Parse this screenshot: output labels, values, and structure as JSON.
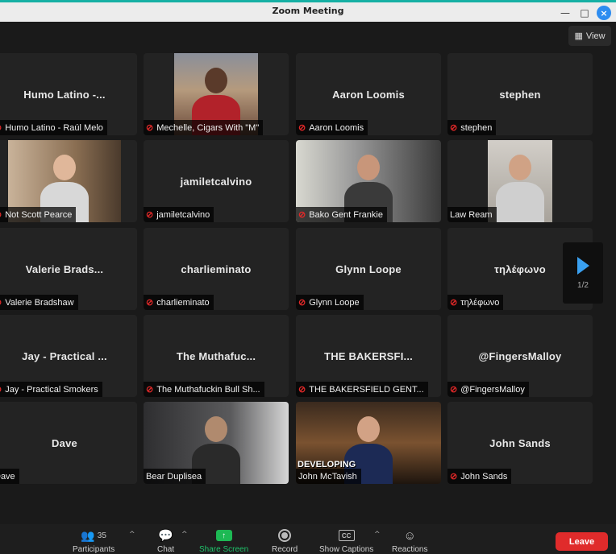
{
  "window": {
    "title": "Zoom Meeting",
    "minimize": "—",
    "maximize": "□",
    "close": "×"
  },
  "view_button": {
    "icon": "grid-icon",
    "label": "View"
  },
  "pager": {
    "page": "1/2"
  },
  "tiles": [
    {
      "big": "Humo Latino -...",
      "label": "Humo Latino - Raúl Melo",
      "muted": true,
      "video": false
    },
    {
      "big": "",
      "label": "Mechelle, Cigars With \"M\"",
      "muted": true,
      "video": true
    },
    {
      "big": "Aaron Loomis",
      "label": "Aaron Loomis",
      "muted": true,
      "video": false
    },
    {
      "big": "stephen",
      "label": "stephen",
      "muted": true,
      "video": false
    },
    {
      "big": "",
      "label": "Not Scott Pearce",
      "muted": true,
      "video": true
    },
    {
      "big": "jamiletcalvino",
      "label": "jamiletcalvino",
      "muted": true,
      "video": false
    },
    {
      "big": "",
      "label": "Bako Gent Frankie",
      "muted": true,
      "video": true
    },
    {
      "big": "",
      "label": "Law Ream",
      "muted": false,
      "video": true
    },
    {
      "big": "Valerie Brads...",
      "label": "Valerie Bradshaw",
      "muted": true,
      "video": false
    },
    {
      "big": "charlieminato",
      "label": "charlieminato",
      "muted": true,
      "video": false
    },
    {
      "big": "Glynn Loope",
      "label": "Glynn Loope",
      "muted": true,
      "video": false
    },
    {
      "big": "τηλέφωνο",
      "label": "τηλέφωνο",
      "muted": true,
      "video": false
    },
    {
      "big": "Jay - Practical ...",
      "label": "Jay - Practical Smokers",
      "muted": true,
      "video": false
    },
    {
      "big": "The Muthafuc...",
      "label": "The Muthafuckin Bull Sh...",
      "muted": true,
      "video": false
    },
    {
      "big": "THE BAKERSFI...",
      "label": "THE BAKERSFIELD GENT...",
      "muted": true,
      "video": false
    },
    {
      "big": "@FingersMalloy",
      "label": "@FingersMalloy",
      "muted": true,
      "video": false
    },
    {
      "big": "Dave",
      "label": "Dave",
      "muted": false,
      "video": false
    },
    {
      "big": "",
      "label": "Bear Duplisea",
      "muted": false,
      "video": true
    },
    {
      "big": "",
      "label": "John McTavish",
      "muted": false,
      "video": true,
      "video_text": "DEVELOPING"
    },
    {
      "big": "John Sands",
      "label": "John Sands",
      "muted": true,
      "video": false
    }
  ],
  "toolbar": {
    "participants": {
      "label": "Participants",
      "count": "35",
      "icon": "participants-icon"
    },
    "chat": {
      "label": "Chat",
      "icon": "chat-icon"
    },
    "share": {
      "label": "Share Screen",
      "icon": "share-screen-icon"
    },
    "record": {
      "label": "Record",
      "icon": "record-icon"
    },
    "captions": {
      "label": "Show Captions",
      "icon": "cc-icon",
      "icon_text": "CC"
    },
    "reactions": {
      "label": "Reactions",
      "icon": "reactions-icon"
    },
    "leave": {
      "label": "Leave"
    }
  },
  "colors": {
    "accent": "#2d8cf0",
    "share": "#1db954",
    "leave": "#e02b2b",
    "muted": "#e02828",
    "tile": "#232323",
    "background": "#1a1a1a"
  }
}
